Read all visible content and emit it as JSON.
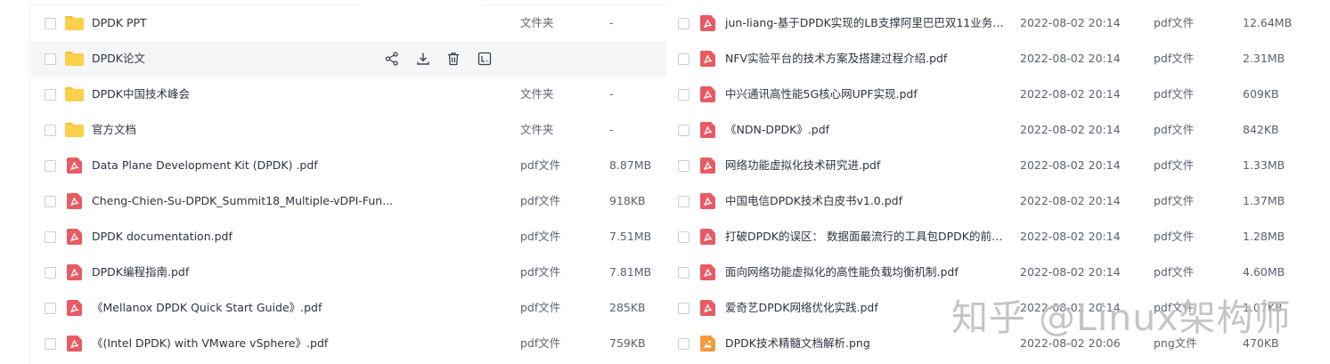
{
  "left_rows": [
    {
      "name": "DPDK  PPT",
      "kind": "folder",
      "type": "文件夹",
      "size": "-"
    },
    {
      "name": "DPDK论文",
      "kind": "folder",
      "type": "",
      "size": "",
      "hover": true
    },
    {
      "name": "DPDK中国技术峰会",
      "kind": "folder",
      "type": "文件夹",
      "size": "-"
    },
    {
      "name": "官方文档",
      "kind": "folder",
      "type": "文件夹",
      "size": "-"
    },
    {
      "name": "Data Plane Development Kit (DPDK) .pdf",
      "kind": "pdf",
      "type": "pdf文件",
      "size": "8.87MB"
    },
    {
      "name": "Cheng-Chien-Su-DPDK_Summit18_Multiple-vDPI-Fun...",
      "kind": "pdf",
      "type": "pdf文件",
      "size": "918KB"
    },
    {
      "name": "DPDK documentation.pdf",
      "kind": "pdf",
      "type": "pdf文件",
      "size": "7.51MB"
    },
    {
      "name": "DPDK编程指南.pdf",
      "kind": "pdf",
      "type": "pdf文件",
      "size": "7.81MB"
    },
    {
      "name": "《Mellanox DPDK Quick Start Guide》.pdf",
      "kind": "pdf",
      "type": "pdf文件",
      "size": "285KB"
    },
    {
      "name": "《(Intel DPDK) with VMware vSphere》.pdf",
      "kind": "pdf",
      "type": "pdf文件",
      "size": "759KB"
    }
  ],
  "right_rows": [
    {
      "name": "jun-liang-基于DPDK实现的LB支撑阿里巴巴双11业务—...",
      "kind": "pdf",
      "date": "2022-08-02 20:14",
      "type": "pdf文件",
      "size": "12.64MB"
    },
    {
      "name": "NFV实验平台的技术方案及搭建过程介绍.pdf",
      "kind": "pdf",
      "date": "2022-08-02 20:14",
      "type": "pdf文件",
      "size": "2.31MB"
    },
    {
      "name": "中兴通讯高性能5G核心网UPF实现.pdf",
      "kind": "pdf",
      "date": "2022-08-02 20:14",
      "type": "pdf文件",
      "size": "609KB"
    },
    {
      "name": "《NDN-DPDK》.pdf",
      "kind": "pdf",
      "date": "2022-08-02 20:14",
      "type": "pdf文件",
      "size": "842KB"
    },
    {
      "name": "网络功能虚拟化技术研究进.pdf",
      "kind": "pdf",
      "date": "2022-08-02 20:14",
      "type": "pdf文件",
      "size": "1.33MB"
    },
    {
      "name": "中国电信DPDK技术白皮书v1.0.pdf",
      "kind": "pdf",
      "date": "2022-08-02 20:14",
      "type": "pdf文件",
      "size": "1.37MB"
    },
    {
      "name": "打破DPDK的误区： 数据面最流行的工具包DPDK的前世...",
      "kind": "pdf",
      "date": "2022-08-02 20:14",
      "type": "pdf文件",
      "size": "1.28MB"
    },
    {
      "name": "面向网络功能虚拟化的高性能负载均衡机制.pdf",
      "kind": "pdf",
      "date": "2022-08-02 20:14",
      "type": "pdf文件",
      "size": "4.60MB"
    },
    {
      "name": "爱奇艺DPDK网络优化实践.pdf",
      "kind": "pdf",
      "date": "2022-08-02 20:14",
      "type": "pdf文件",
      "size": "1.07KB"
    },
    {
      "name": "DPDK技术精髓文档解析.png",
      "kind": "png",
      "date": "2022-08-02 20:06",
      "type": "png文件",
      "size": "470KB"
    }
  ],
  "hover_actions": [
    "share-icon",
    "download-icon",
    "delete-icon",
    "more-icon"
  ],
  "watermark": "知乎 @Linux架构师",
  "colors": {
    "folder": "#fbd04a",
    "pdf": "#ea5a63",
    "png": "#f59a3b",
    "hover_row": "#f5f6f8"
  }
}
